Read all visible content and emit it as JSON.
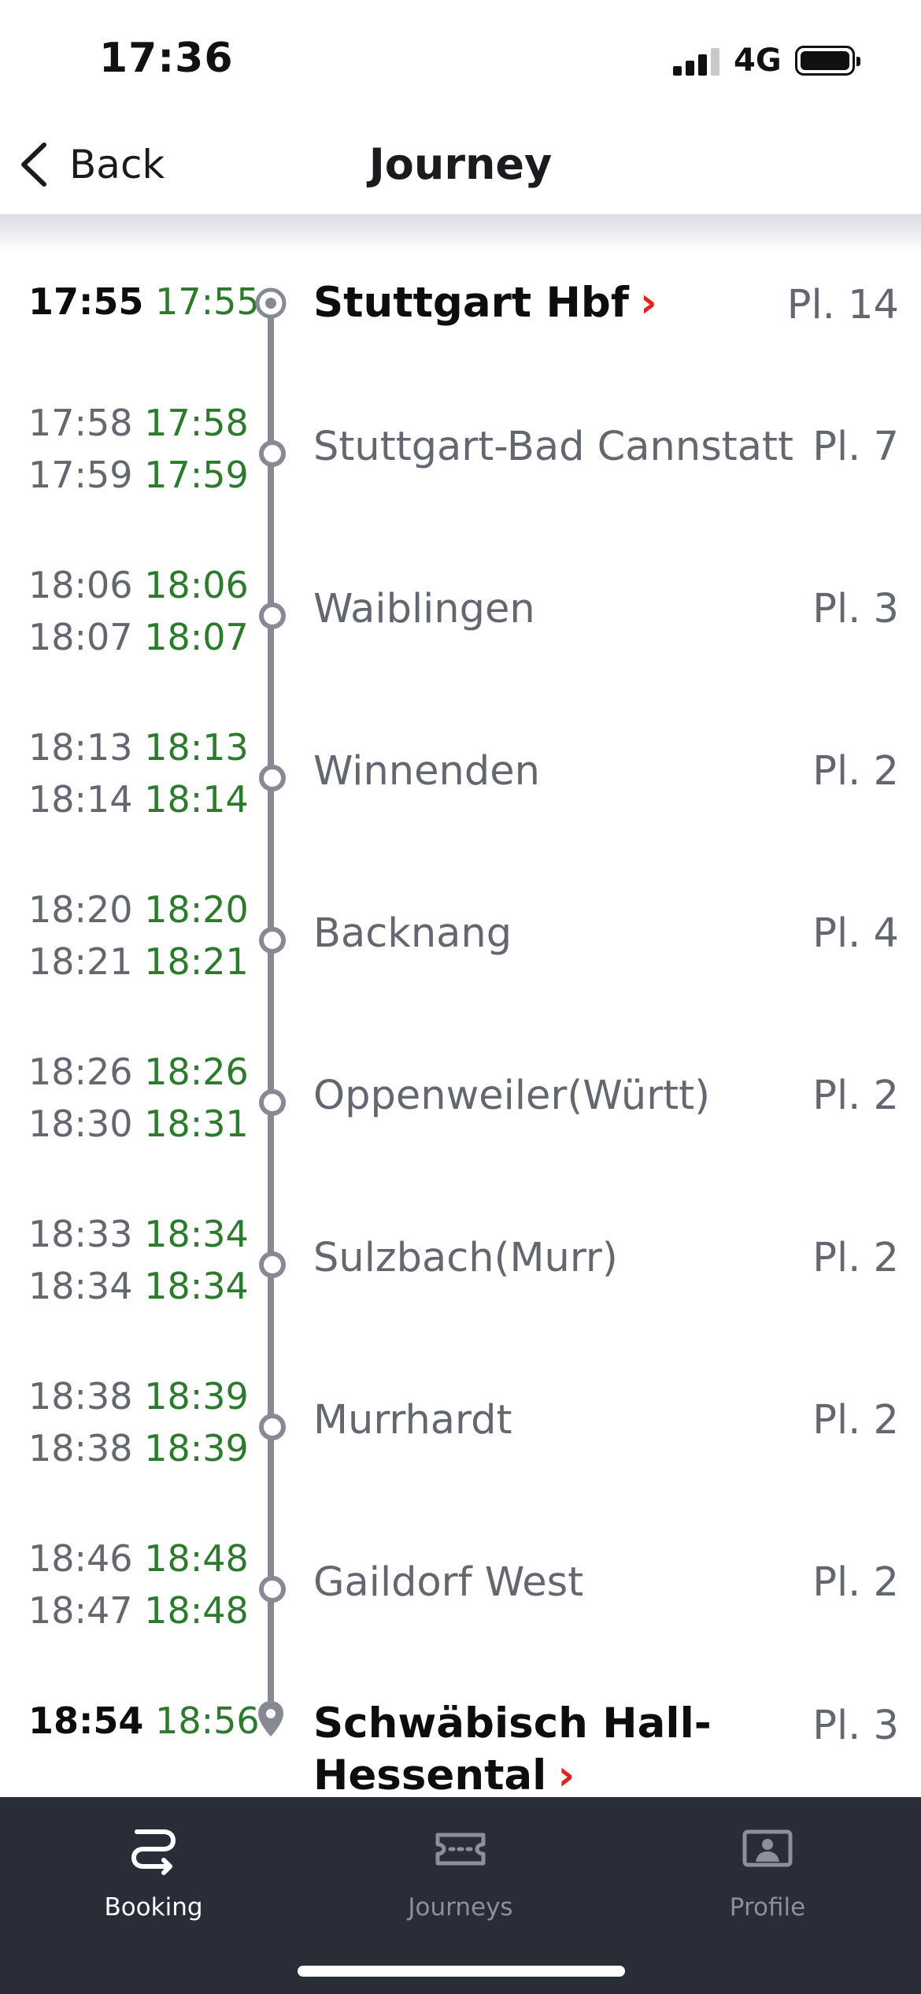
{
  "status_bar": {
    "time": "17:36",
    "network": "4G"
  },
  "header": {
    "back_label": "Back",
    "title": "Journey"
  },
  "stops": [
    {
      "station": "Stuttgart Hbf",
      "platform": "Pl. 14",
      "dep_planned": "17:55",
      "dep_actual": "17:55"
    },
    {
      "station": "Stuttgart-Bad Cannstatt",
      "platform": "Pl. 7",
      "arr_planned": "17:58",
      "arr_actual": "17:58",
      "dep_planned": "17:59",
      "dep_actual": "17:59"
    },
    {
      "station": "Waiblingen",
      "platform": "Pl. 3",
      "arr_planned": "18:06",
      "arr_actual": "18:06",
      "dep_planned": "18:07",
      "dep_actual": "18:07"
    },
    {
      "station": "Winnenden",
      "platform": "Pl. 2",
      "arr_planned": "18:13",
      "arr_actual": "18:13",
      "dep_planned": "18:14",
      "dep_actual": "18:14"
    },
    {
      "station": "Backnang",
      "platform": "Pl. 4",
      "arr_planned": "18:20",
      "arr_actual": "18:20",
      "dep_planned": "18:21",
      "dep_actual": "18:21"
    },
    {
      "station": "Oppenweiler(Württ)",
      "platform": "Pl. 2",
      "arr_planned": "18:26",
      "arr_actual": "18:26",
      "dep_planned": "18:30",
      "dep_actual": "18:31"
    },
    {
      "station": "Sulzbach(Murr)",
      "platform": "Pl. 2",
      "arr_planned": "18:33",
      "arr_actual": "18:34",
      "dep_planned": "18:34",
      "dep_actual": "18:34"
    },
    {
      "station": "Murrhardt",
      "platform": "Pl. 2",
      "arr_planned": "18:38",
      "arr_actual": "18:39",
      "dep_planned": "18:38",
      "dep_actual": "18:39"
    },
    {
      "station": "Gaildorf West",
      "platform": "Pl. 2",
      "arr_planned": "18:46",
      "arr_actual": "18:48",
      "dep_planned": "18:47",
      "dep_actual": "18:48"
    },
    {
      "station_line1": "Schwäbisch Hall-",
      "station_line2": "Hessental",
      "platform": "Pl. 3",
      "arr_planned": "18:54",
      "arr_actual": "18:56"
    }
  ],
  "chevron": "›",
  "tabs": [
    {
      "label": "Booking",
      "icon": "route-icon",
      "active": true
    },
    {
      "label": "Journeys",
      "icon": "ticket-icon",
      "active": false
    },
    {
      "label": "Profile",
      "icon": "profile-icon",
      "active": false
    }
  ],
  "colors": {
    "on_time": "#2c7a2c",
    "chevron": "#e4231a",
    "tab_bar": "#282d37",
    "track": "#878993"
  }
}
